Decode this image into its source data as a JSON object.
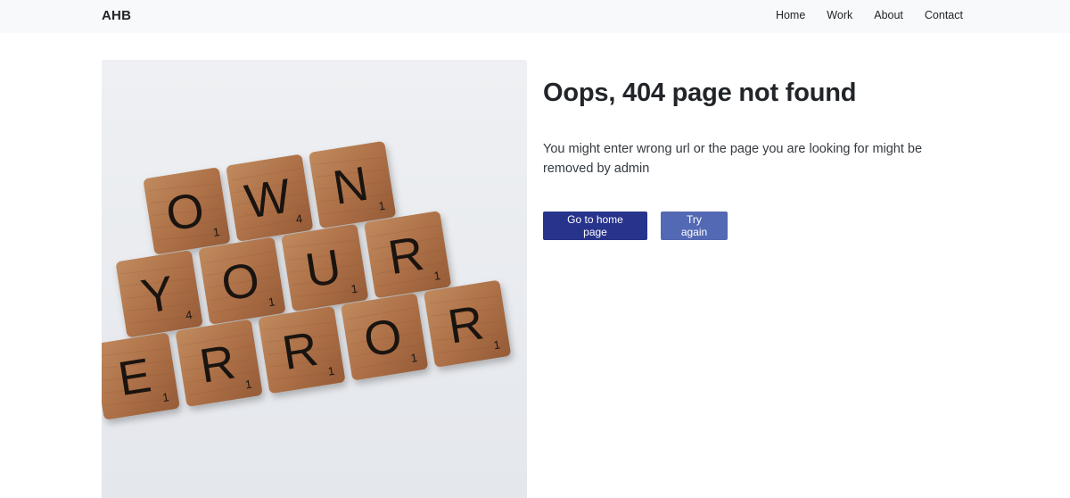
{
  "nav": {
    "brand": "AHB",
    "links": [
      "Home",
      "Work",
      "About",
      "Contact"
    ]
  },
  "image": {
    "alt": "Scrabble tiles spelling OWN YOUR ERROR",
    "rows": [
      {
        "letters": [
          "O",
          "W",
          "N"
        ],
        "scores": [
          "1",
          "4",
          "1"
        ]
      },
      {
        "letters": [
          "Y",
          "O",
          "U",
          "R"
        ],
        "scores": [
          "4",
          "1",
          "1",
          "1"
        ]
      },
      {
        "letters": [
          "E",
          "R",
          "R",
          "O",
          "R"
        ],
        "scores": [
          "1",
          "1",
          "1",
          "1",
          "1"
        ]
      }
    ]
  },
  "error": {
    "title": "Oops, 404 page not found",
    "description": "You might enter wrong url or the page you are looking for might be removed by admin",
    "primary_button": "Go to home page",
    "secondary_button": "Try again"
  },
  "colors": {
    "primary": "#27348b",
    "secondary": "#5469b3",
    "navbar_bg": "#f8f9fa",
    "tile": "#b0744a"
  }
}
